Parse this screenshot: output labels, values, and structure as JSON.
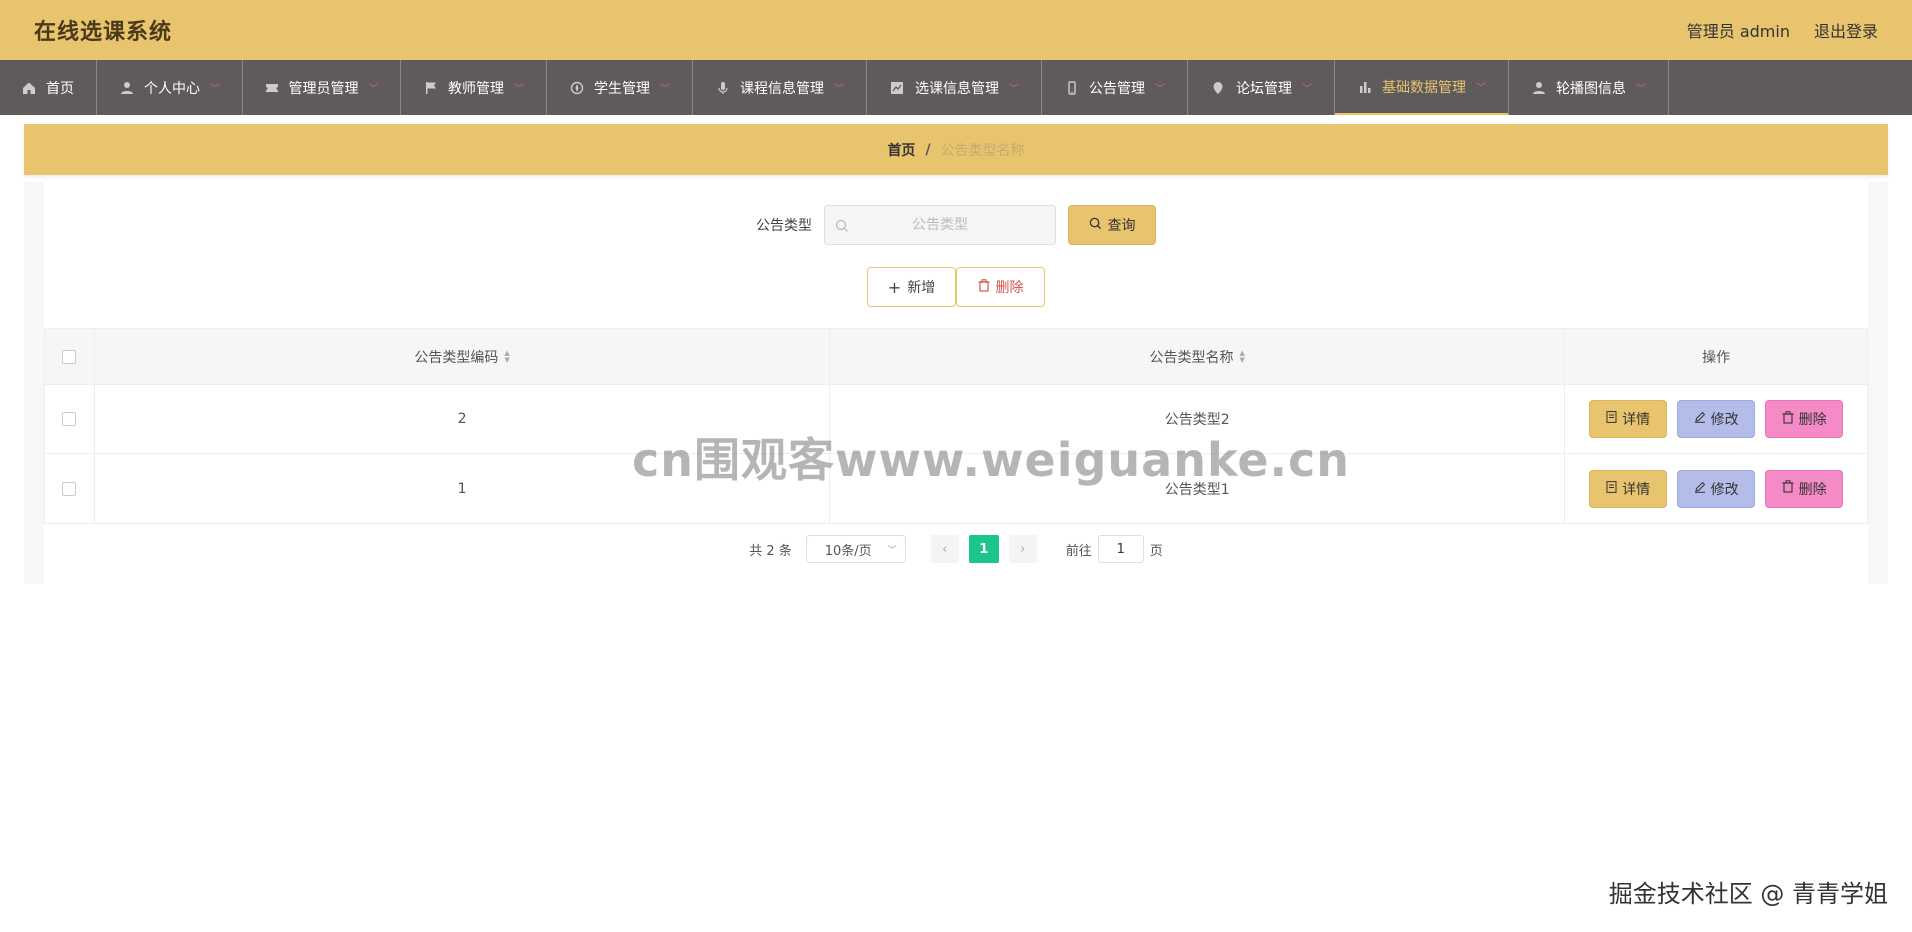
{
  "app": {
    "title": "在线选课系统"
  },
  "header": {
    "user_label": "管理员 admin",
    "logout_label": "退出登录"
  },
  "nav": {
    "items": [
      {
        "label": "首页",
        "icon": "home-icon",
        "active": false,
        "has_chevron": false
      },
      {
        "label": "个人中心",
        "icon": "user-icon",
        "active": false,
        "has_chevron": true
      },
      {
        "label": "管理员管理",
        "icon": "ticket-icon",
        "active": false,
        "has_chevron": true
      },
      {
        "label": "教师管理",
        "icon": "flag-icon",
        "active": false,
        "has_chevron": true
      },
      {
        "label": "学生管理",
        "icon": "compass-icon",
        "active": false,
        "has_chevron": true
      },
      {
        "label": "课程信息管理",
        "icon": "microphone-icon",
        "active": false,
        "has_chevron": true
      },
      {
        "label": "选课信息管理",
        "icon": "chart-box-icon",
        "active": false,
        "has_chevron": true
      },
      {
        "label": "公告管理",
        "icon": "mobile-icon",
        "active": false,
        "has_chevron": true
      },
      {
        "label": "论坛管理",
        "icon": "location-icon",
        "active": false,
        "has_chevron": true
      },
      {
        "label": "基础数据管理",
        "icon": "bar-chart-icon",
        "active": true,
        "has_chevron": true
      },
      {
        "label": "轮播图信息",
        "icon": "user-icon",
        "active": false,
        "has_chevron": true
      }
    ]
  },
  "breadcrumb": {
    "home": "首页",
    "separator": "/",
    "current": "公告类型名称"
  },
  "search": {
    "label": "公告类型",
    "placeholder": "公告类型",
    "button_label": "查询"
  },
  "actions": {
    "add_label": "新增",
    "delete_label": "删除"
  },
  "table": {
    "columns": {
      "code": "公告类型编码",
      "name": "公告类型名称",
      "ops": "操作"
    },
    "rows": [
      {
        "code": "2",
        "name": "公告类型2"
      },
      {
        "code": "1",
        "name": "公告类型1"
      }
    ],
    "row_buttons": {
      "detail": "详情",
      "edit": "修改",
      "delete": "删除"
    }
  },
  "pagination": {
    "total_text": "共 2 条",
    "page_size": "10条/页",
    "current_page": "1",
    "goto_label": "前往",
    "goto_value": "1",
    "page_suffix": "页"
  },
  "watermark": {
    "center": "cn围观客www.weiguanke.cn",
    "corner": "掘金技术社区 @ 青青学姐"
  },
  "colors": {
    "header_bg": "#e8c46e",
    "nav_bg": "#5f5a5c",
    "accent": "#e8c46e",
    "edit_btn": "#b4bde9",
    "delete_btn": "#f58ac7",
    "page_active": "#1bc58c"
  }
}
